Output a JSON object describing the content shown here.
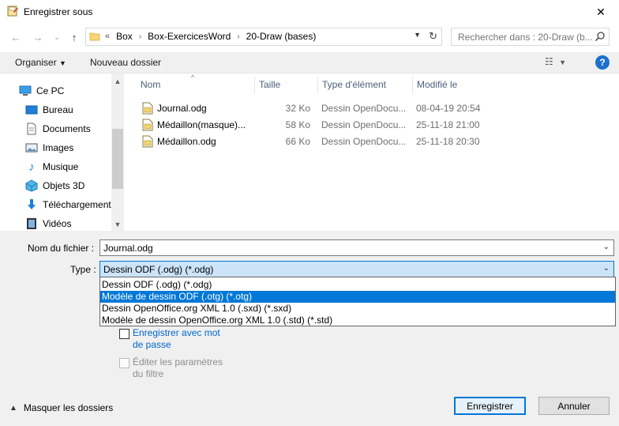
{
  "window": {
    "title": "Enregistrer sous",
    "close": "✕"
  },
  "address": {
    "prefix": "«",
    "crumbs": [
      "Box",
      "Box-ExercicesWord",
      "20-Draw (bases)"
    ]
  },
  "search": {
    "placeholder": "Rechercher dans : 20-Draw (b..."
  },
  "toolbar": {
    "organize": "Organiser",
    "new_folder": "Nouveau dossier",
    "help": "?"
  },
  "sidebar": {
    "items": [
      {
        "label": "Ce PC",
        "icon": "computer-icon"
      },
      {
        "label": "Bureau",
        "icon": "desktop-icon"
      },
      {
        "label": "Documents",
        "icon": "documents-icon"
      },
      {
        "label": "Images",
        "icon": "images-icon"
      },
      {
        "label": "Musique",
        "icon": "music-icon"
      },
      {
        "label": "Objets 3D",
        "icon": "3d-objects-icon"
      },
      {
        "label": "Téléchargement",
        "icon": "downloads-icon"
      },
      {
        "label": "Vidéos",
        "icon": "videos-icon"
      }
    ]
  },
  "columns": {
    "name": "Nom",
    "size": "Taille",
    "type": "Type d'élément",
    "modified": "Modifié le"
  },
  "files": [
    {
      "name": "Journal.odg",
      "size": "32 Ko",
      "type": "Dessin OpenDocu...",
      "modified": "08-04-19 20:54"
    },
    {
      "name": "Médaillon(masque)...",
      "size": "58 Ko",
      "type": "Dessin OpenDocu...",
      "modified": "25-11-18 21:00"
    },
    {
      "name": "Médaillon.odg",
      "size": "66 Ko",
      "type": "Dessin OpenDocu...",
      "modified": "25-11-18 20:30"
    }
  ],
  "form": {
    "filename_label": "Nom du fichier :",
    "filename_value": "Journal.odg",
    "type_label": "Type :",
    "type_value": "Dessin ODF (.odg) (*.odg)"
  },
  "type_options": [
    "Dessin ODF (.odg) (*.odg)",
    "Modèle de dessin ODF (.otg) (*.otg)",
    "Dessin OpenOffice.org XML 1.0 (.sxd) (*.sxd)",
    "Modèle de dessin OpenOffice.org XML 1.0 (.std) (*.std)"
  ],
  "options": {
    "password_line1": "Enregistrer avec mot",
    "password_line2": "de passe",
    "filter_line1": "Éditer les paramètres",
    "filter_line2": "du filtre"
  },
  "footer": {
    "hide_folders": "Masquer les dossiers",
    "save": "Enregistrer",
    "cancel": "Annuler"
  },
  "colors": {
    "accent": "#0078d7",
    "selected_option_bg": "#0078d7",
    "link": "#0066cc"
  }
}
